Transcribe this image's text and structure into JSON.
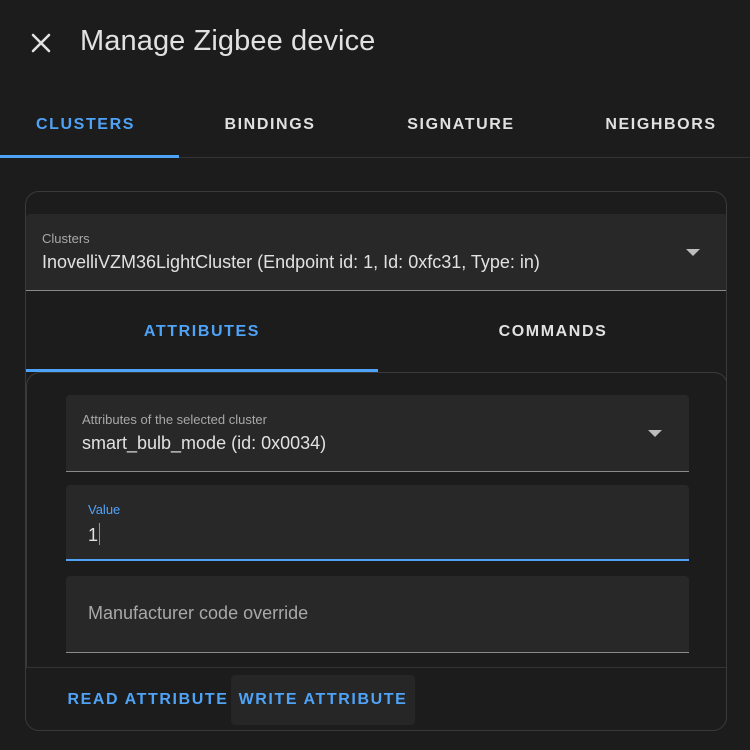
{
  "dialog": {
    "title": "Manage Zigbee device"
  },
  "icons": {
    "close": "close-icon",
    "dropdown": "chevron-down-icon"
  },
  "tabs": [
    {
      "label": "CLUSTERS",
      "active": true
    },
    {
      "label": "BINDINGS",
      "active": false
    },
    {
      "label": "SIGNATURE",
      "active": false
    },
    {
      "label": "NEIGHBORS",
      "active": false
    }
  ],
  "cluster_select": {
    "label": "Clusters",
    "value": "InovelliVZM36LightCluster (Endpoint id: 1, Id: 0xfc31, Type: in)"
  },
  "sub_tabs": [
    {
      "label": "ATTRIBUTES",
      "active": true
    },
    {
      "label": "COMMANDS",
      "active": false
    }
  ],
  "attribute_select": {
    "label": "Attributes of the selected cluster",
    "value": "smart_bulb_mode (id: 0x0034)"
  },
  "value_field": {
    "label": "Value",
    "value": "1"
  },
  "manufacturer_field": {
    "placeholder": "Manufacturer code override"
  },
  "actions": {
    "read": "READ ATTRIBUTE",
    "write": "WRITE ATTRIBUTE"
  },
  "colors": {
    "accent": "#4fa3f7",
    "background": "#1c1c1c",
    "field": "#282828"
  }
}
